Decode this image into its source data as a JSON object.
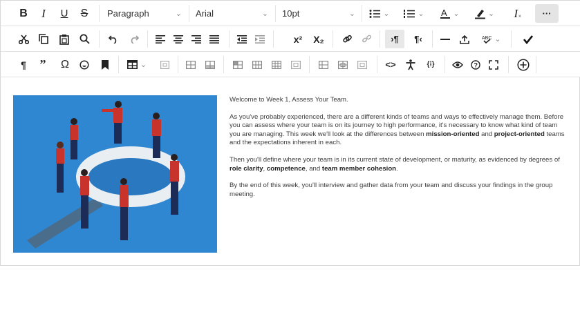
{
  "toolbar": {
    "bold": "B",
    "italic": "I",
    "underline": "U",
    "strikethrough": "S",
    "block_format": "Paragraph",
    "font_family": "Arial",
    "font_size": "10pt",
    "superscript": "x²",
    "subscript": "X₂",
    "clear_format": "I",
    "more": "···",
    "omega": "Ω",
    "code": "<>",
    "variable": "{⁞}"
  },
  "content": {
    "p1": "Welcome to Week 1, Assess Your Team.",
    "p2_a": "As you've probably experienced, there are a different kinds of teams and ways to effectively manage them. Before you can assess where your team is on its journey to high performance, it's necessary to know what kind of team you are managing. This week we'll look at the differences between ",
    "p2_b1": "mission-oriented",
    "p2_and": " and ",
    "p2_b2": "project-oriented",
    "p2_c": " teams and the expectations inherent in each.",
    "p3_a": "Then you'll define where your team is in its current state of development, or maturity, as evidenced by degrees of ",
    "p3_b1": "role clarity",
    "p3_sep1": ", ",
    "p3_b2": "competence",
    "p3_sep2": ", and ",
    "p3_b3": "team member cohesion",
    "p3_end": ".",
    "p4": "By the end of this week, you'll interview and gather data from your team and discuss your findings in the group meeting."
  },
  "colors": {
    "illustration_bg": "#2f86d1",
    "figure_red": "#c8332b",
    "figure_navy": "#1d2b57",
    "magnifier_ring": "#e8eef2"
  }
}
